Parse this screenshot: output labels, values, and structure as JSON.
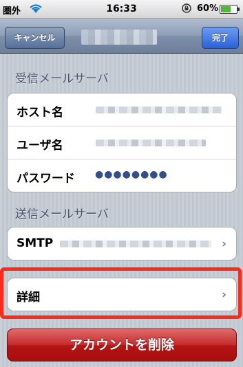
{
  "status_bar": {
    "carrier": "圏外",
    "time": "16:33",
    "battery_percent": "60%"
  },
  "nav": {
    "cancel_label": "キャンセル",
    "done_label": "完了"
  },
  "incoming": {
    "header": "受信メールサーバ",
    "host_label": "ホスト名",
    "user_label": "ユーザ名",
    "password_label": "パスワード",
    "password_mask": "●●●●●●●●"
  },
  "outgoing": {
    "header": "送信メールサーバ",
    "smtp_label": "SMTP"
  },
  "advanced": {
    "label": "詳細"
  },
  "delete_account_label": "アカウントを削除",
  "colors": {
    "highlight": "#ff2a1a",
    "delete_button": "#b41515",
    "done_button": "#2a62d6"
  },
  "icons": [
    "wifi-icon",
    "rotation-lock-icon",
    "battery-icon",
    "chevron-right-icon"
  ]
}
